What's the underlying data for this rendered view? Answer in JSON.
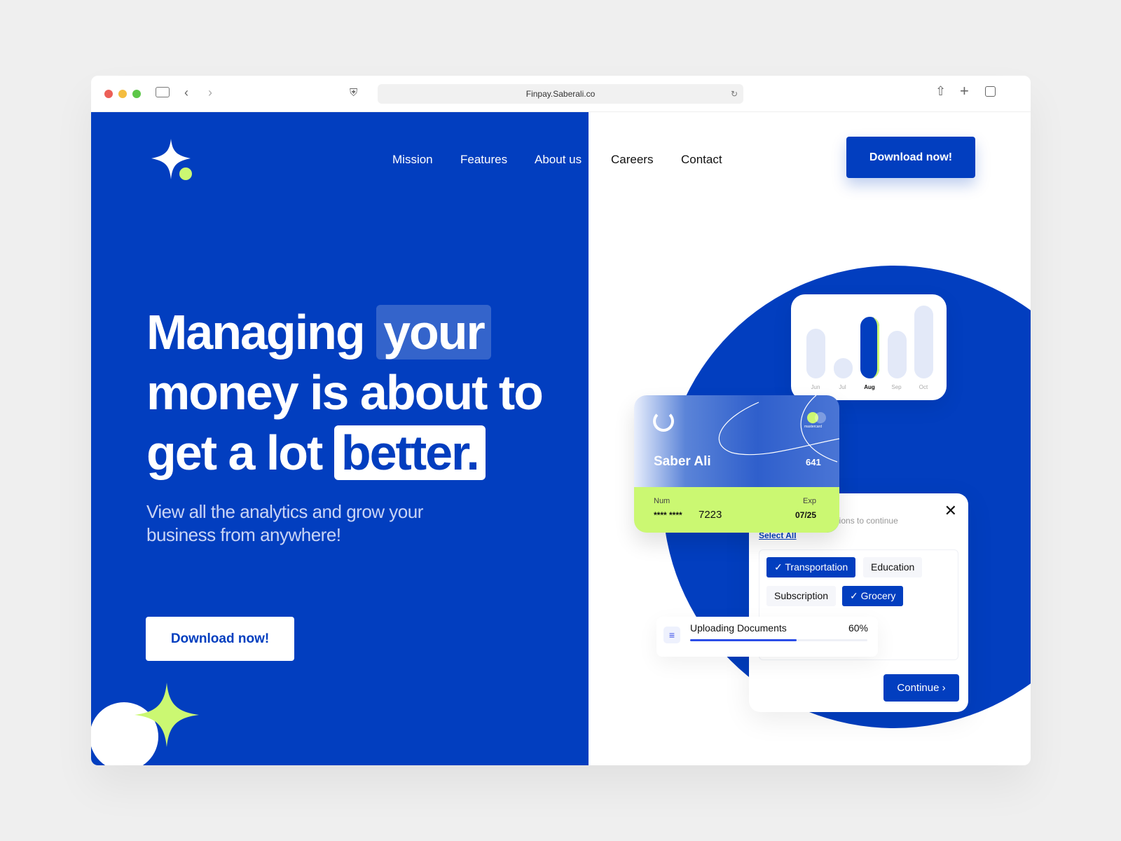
{
  "browser": {
    "url": "Finpay.Saberali.co",
    "traffic_lights": [
      "#ec5f57",
      "#f4bd3f",
      "#5dc748"
    ]
  },
  "nav": {
    "items": [
      "Mission",
      "Features",
      "About us",
      "Careers",
      "Contact"
    ],
    "cta": "Download now!"
  },
  "hero": {
    "line1a": "Managing",
    "line1b": "your",
    "line2": "money is about to",
    "line3a": "get a lot",
    "line3b": "better.",
    "subtitle": "View all the analytics and grow your business from anywhere!",
    "cta": "Download now!"
  },
  "chart_card": {
    "months": [
      "Jun",
      "Jul",
      "Aug",
      "Sep",
      "Oct"
    ],
    "levels": [
      0.68,
      0.28,
      0.85,
      0.65,
      1.0
    ],
    "active": "Aug"
  },
  "credit_card": {
    "name": "Saber Ali",
    "cvv": "641",
    "brand": "mastercard",
    "num_label": "Num",
    "number_masked": "**** ****",
    "number_last": "7223",
    "exp_label": "Exp",
    "exp": "07/25"
  },
  "modal": {
    "hint": "options to continue",
    "select_all": "Select All",
    "chips": [
      {
        "label": "Transportation",
        "selected": true
      },
      {
        "label": "Education",
        "selected": false
      },
      {
        "label": "Subscription",
        "selected": false
      },
      {
        "label": "Grocery",
        "selected": true
      }
    ],
    "continue": "Continue"
  },
  "upload": {
    "label": "Uploading Documents",
    "percent": "60%",
    "progress": 0.6
  },
  "colors": {
    "brand_blue": "#023ebf",
    "lime": "#cbf872"
  }
}
